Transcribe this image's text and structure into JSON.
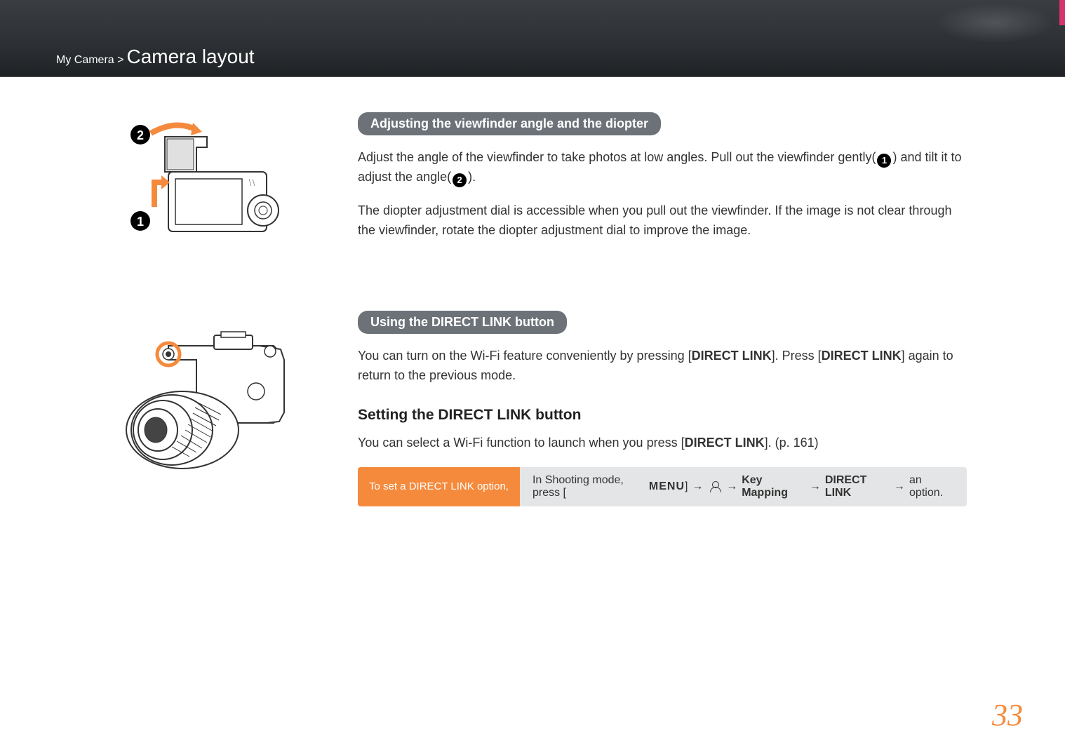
{
  "breadcrumb": {
    "parent": "My Camera >",
    "current": " Camera layout"
  },
  "section1": {
    "heading": "Adjusting the viewfinder angle and the diopter",
    "para1_a": "Adjust the angle of the viewfinder to take photos at low angles. Pull out the viewfinder gently(",
    "para1_b": ") and tilt it to adjust the angle(",
    "para1_c": ").",
    "para2": "The diopter adjustment dial is accessible when you pull out the viewfinder. If the image is not clear through the viewfinder, rotate the diopter adjustment dial to improve the image.",
    "number1": "1",
    "number2": "2"
  },
  "section2": {
    "heading": "Using the DIRECT LINK button",
    "para1_a": "You can turn on the Wi-Fi feature conveniently by pressing [",
    "para1_b": "DIRECT LINK",
    "para1_c": "]. Press [",
    "para1_d": "DIRECT LINK",
    "para1_e": "] again to return to the previous mode.",
    "subheading": "Setting the DIRECT LINK button",
    "para2_a": "You can select a Wi-Fi function to launch when you press [",
    "para2_b": "DIRECT LINK",
    "para2_c": "]. (p. 161)",
    "callout_label": "To set a DIRECT LINK option,",
    "callout_a": "In Shooting mode, press [",
    "callout_menu": "MENU",
    "callout_b": "]",
    "callout_arrow": "→",
    "callout_keymapping": "Key Mapping",
    "callout_directlink": "DIRECT LINK",
    "callout_end": "an option."
  },
  "page_number": "33"
}
